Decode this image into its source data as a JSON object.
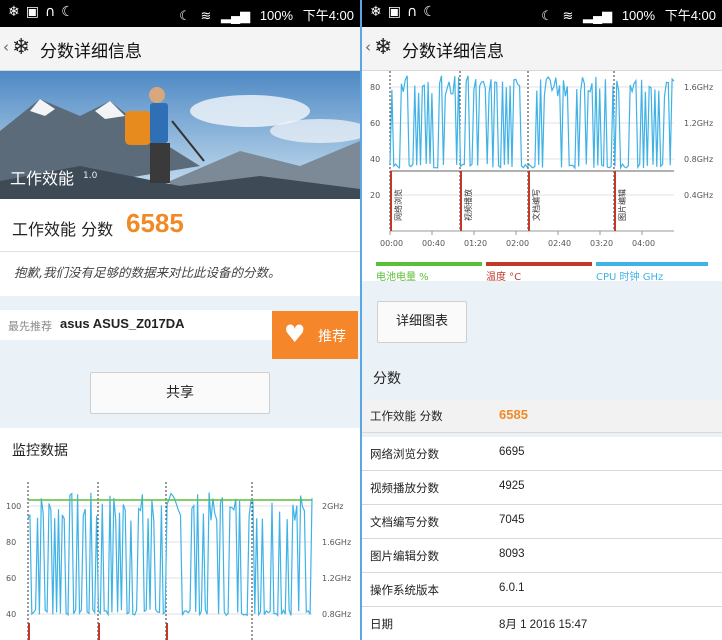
{
  "status_bar": {
    "left_icons": [
      "snowflake-icon",
      "image-icon",
      "headphones-icon",
      "moon-icon"
    ],
    "battery": "100%",
    "time": "下午4:00"
  },
  "app_bar": {
    "back": "‹",
    "title": "分数详细信息"
  },
  "left": {
    "hero": {
      "label": "工作效能",
      "version": "1.0"
    },
    "score": {
      "label": "工作效能 分数",
      "value": "6585"
    },
    "note": "抱歉,我们没有足够的数据来对比此设备的分数。",
    "recommend": {
      "prefix": "最先推荐",
      "device": "asus ASUS_Z017DA",
      "button": "推荐"
    },
    "share_button": "共享",
    "monitor_title": "监控数据"
  },
  "right": {
    "detail_button": "详细图表",
    "scores_title": "分数",
    "rows": [
      {
        "key": "工作效能 分数",
        "value": "6585"
      },
      {
        "key": "网络浏览分数",
        "value": "6695"
      },
      {
        "key": "视频播放分数",
        "value": "4925"
      },
      {
        "key": "文档编写分数",
        "value": "7045"
      },
      {
        "key": "图片编辑分数",
        "value": "8093"
      },
      {
        "key": "操作系统版本",
        "value": "6.0.1"
      },
      {
        "key": "日期",
        "value": "8月 1 2016 15:47"
      }
    ],
    "legend": [
      {
        "label": "电池电量 %",
        "color": "#5cbf3a"
      },
      {
        "label": "温度 °C",
        "color": "#c0392b"
      },
      {
        "label": "CPU 时钟 GHz",
        "color": "#3fb2e6"
      }
    ]
  },
  "chart_data": [
    {
      "type": "line",
      "title": "监控数据",
      "y_left_ticks": [
        "40",
        "60",
        "80",
        "100"
      ],
      "y_right_ticks": [
        "0.8GHz",
        "1.2GHz",
        "1.6GHz",
        "2GHz"
      ],
      "series": [
        {
          "name": "电池电量 %",
          "color": "#5cbf3a",
          "values": [
            100,
            100,
            99,
            99
          ]
        },
        {
          "name": "CPU 时钟 GHz",
          "color": "#3fb2e6"
        }
      ]
    },
    {
      "type": "line",
      "x_ticks": [
        "00:00",
        "00:40",
        "01:20",
        "02:00",
        "02:40",
        "03:20",
        "04:00"
      ],
      "y_left_ticks": [
        "20",
        "40",
        "60",
        "80"
      ],
      "y_right_ticks": [
        "0.4GHz",
        "0.8GHz",
        "1.2GHz",
        "1.6GHz"
      ],
      "annotations": [
        "网络浏览",
        "视频播放",
        "文档编写",
        "图片编辑"
      ],
      "series": [
        {
          "name": "电池电量 %",
          "color": "#5cbf3a"
        },
        {
          "name": "温度 °C",
          "color": "#c0392b"
        },
        {
          "name": "CPU 时钟 GHz",
          "color": "#3fb2e6"
        }
      ]
    }
  ]
}
